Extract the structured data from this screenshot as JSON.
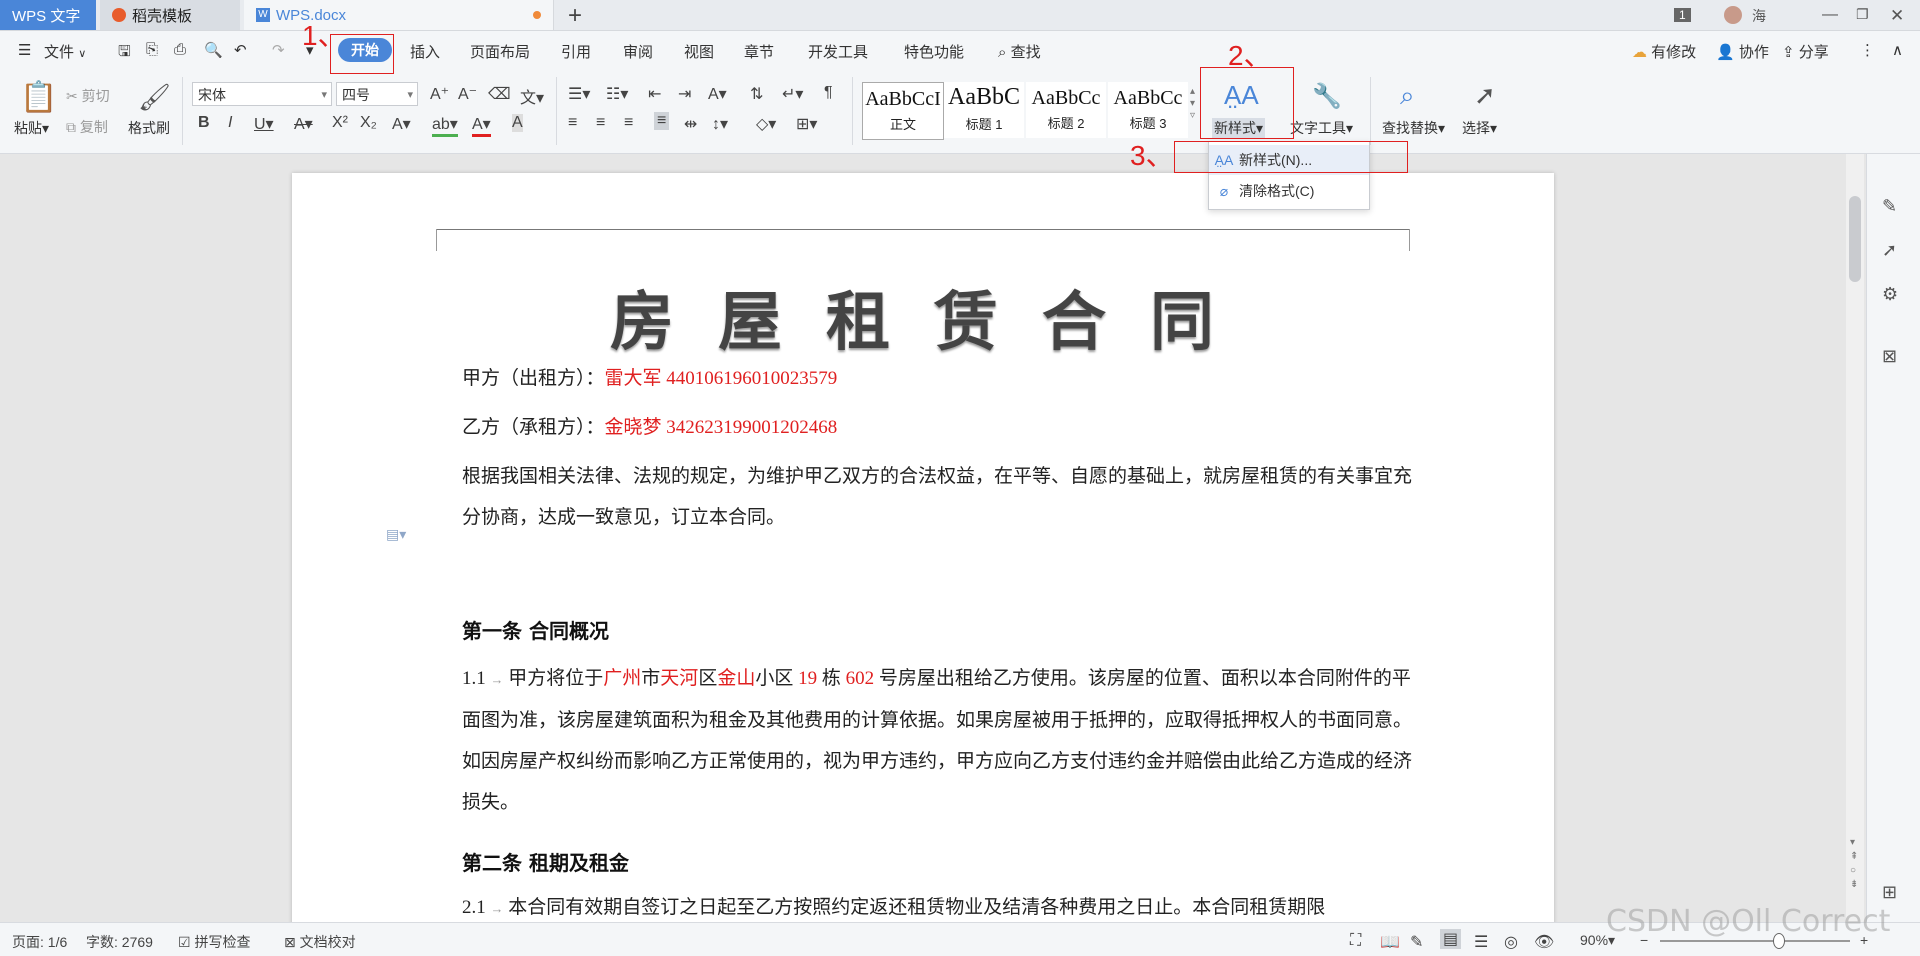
{
  "titlebar": {
    "tabs": [
      {
        "label": "WPS 文字"
      },
      {
        "label": "稻壳模板"
      },
      {
        "label": "WPS.docx"
      }
    ],
    "add_tab": "+",
    "page_count_badge": "1",
    "user_name": "海"
  },
  "menubar": {
    "file": "文件",
    "items": [
      "开始",
      "插入",
      "页面布局",
      "引用",
      "审阅",
      "视图",
      "章节",
      "开发工具",
      "特色功能"
    ],
    "search": "查找",
    "right": [
      "有修改",
      "协作",
      "分享"
    ]
  },
  "ribbon": {
    "paste": "粘贴",
    "cut": "剪切",
    "copy": "复制",
    "format_painter": "格式刷",
    "font_name": "宋体",
    "font_size": "四号",
    "styles": [
      {
        "sample": "AaBbCcI",
        "name": "正文"
      },
      {
        "sample": "AaBbC",
        "name": "标题 1"
      },
      {
        "sample": "AaBbCc",
        "name": "标题 2"
      },
      {
        "sample": "AaBbCc",
        "name": "标题 3"
      }
    ],
    "new_style": "新样式",
    "text_tools": "文字工具",
    "find_replace": "查找替换",
    "select": "选择"
  },
  "annotations": [
    "1、",
    "2、",
    "3、"
  ],
  "dropdown": {
    "new_style_item": "新样式(N)...",
    "clear_format_item": "清除格式(C)"
  },
  "document": {
    "title": "房屋租赁合同",
    "party_a_label": "甲方（出租方）：",
    "party_a_value": "雷大军 440106196010023579",
    "party_b_label": "乙方（承租方）：",
    "party_b_value": "金晓梦 342623199001202468",
    "intro": "根据我国相关法律、法规的规定，为维护甲乙双方的合法权益，在平等、自愿的基础上，就房屋租赁的有关事宜充分协商，达成一致意见，订立本合同。",
    "section1_title": "第一条 合同概况",
    "s1_num": "1.1",
    "s1_pre": "甲方将位于",
    "s1_city": "广州",
    "s1_city_suffix": "市",
    "s1_district": "天河",
    "s1_district_suffix": "区",
    "s1_area": "金山",
    "s1_area_suffix": "小区 ",
    "s1_building": "19",
    "s1_building_suffix": " 栋 ",
    "s1_room": "602",
    "s1_rest": " 号房屋出租给乙方使用。该房屋的位置、面积以本合同附件的平面图为准，该房屋建筑面积为租金及其他费用的计算依据。如果房屋被用于抵押的，应取得抵押权人的书面同意。如因房屋产权纠纷而影响乙方正常使用的，视为甲方违约，甲方应向乙方支付违约金并赔偿由此给乙方造成的经济损失。",
    "section2_title": "第二条 租期及租金",
    "s2_num": "2.1",
    "s2_text": "本合同有效期自签订之日起至乙方按照约定返还租赁物业及结清各种费用之日止。本合同租赁期限"
  },
  "statusbar": {
    "page": "页面: 1/6",
    "words": "字数: 2769",
    "spell": "拼写检查",
    "proof": "文档校对",
    "zoom": "90%",
    "zoom_level": 0.62
  },
  "watermark": "CSDN @Oll Correct",
  "colors": {
    "accent": "#4a86d8",
    "annotation_red": "#e02020",
    "doc_red": "#e02020"
  }
}
